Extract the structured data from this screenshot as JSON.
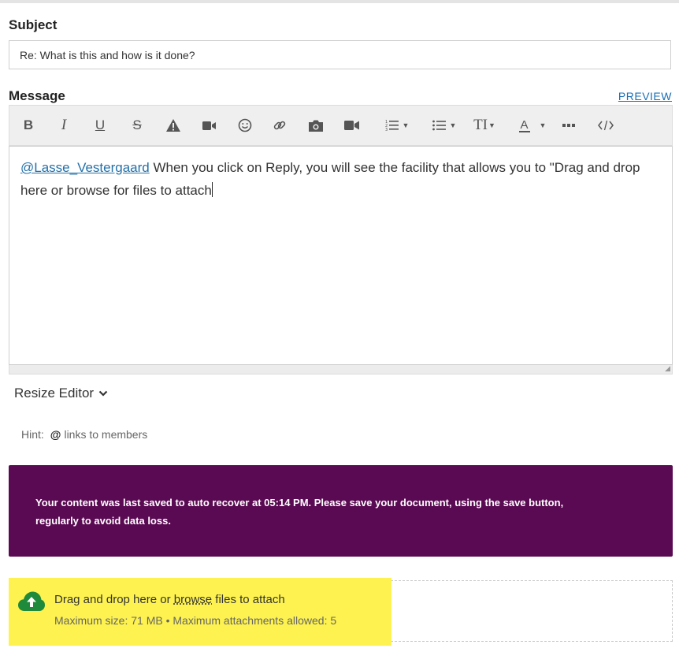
{
  "subject": {
    "label": "Subject",
    "value": "Re: What is this and how is it done?"
  },
  "message": {
    "label": "Message",
    "preview_label": "PREVIEW"
  },
  "toolbar": {
    "buttons": [
      "bold-icon",
      "italic-icon",
      "underline-icon",
      "strikethrough-icon",
      "warning-icon",
      "video-icon",
      "emoji-icon",
      "link-icon",
      "camera-icon",
      "video-camera-icon",
      "ordered-list-icon",
      "bullet-list-icon",
      "text-size-icon",
      "text-color-icon",
      "more-icon",
      "source-code-icon"
    ],
    "text_size_glyph": "TI",
    "text_color_glyph": "A"
  },
  "editor": {
    "mention": "@Lasse_Vestergaard",
    "body": " When you click on Reply, you will see the facility that allows you to \"Drag and drop here or browse for files to attach"
  },
  "resize": {
    "label": "Resize Editor"
  },
  "hint": {
    "label": "Hint:",
    "symbol": "@",
    "text": "links to members"
  },
  "autosave": {
    "line1": "Your content was last saved to auto recover at 05:14 PM. Please save your document, using the save button,",
    "line2": "regularly to avoid data loss.",
    "background": "#5a0a52"
  },
  "attachments": {
    "prefix": "Drag and drop here or ",
    "browse": "browse",
    "suffix": " files to attach",
    "limits": "Maximum size: 71 MB • Maximum attachments allowed: 5",
    "highlight_color": "#fdf24f",
    "icon_color": "#1f8a3c"
  }
}
